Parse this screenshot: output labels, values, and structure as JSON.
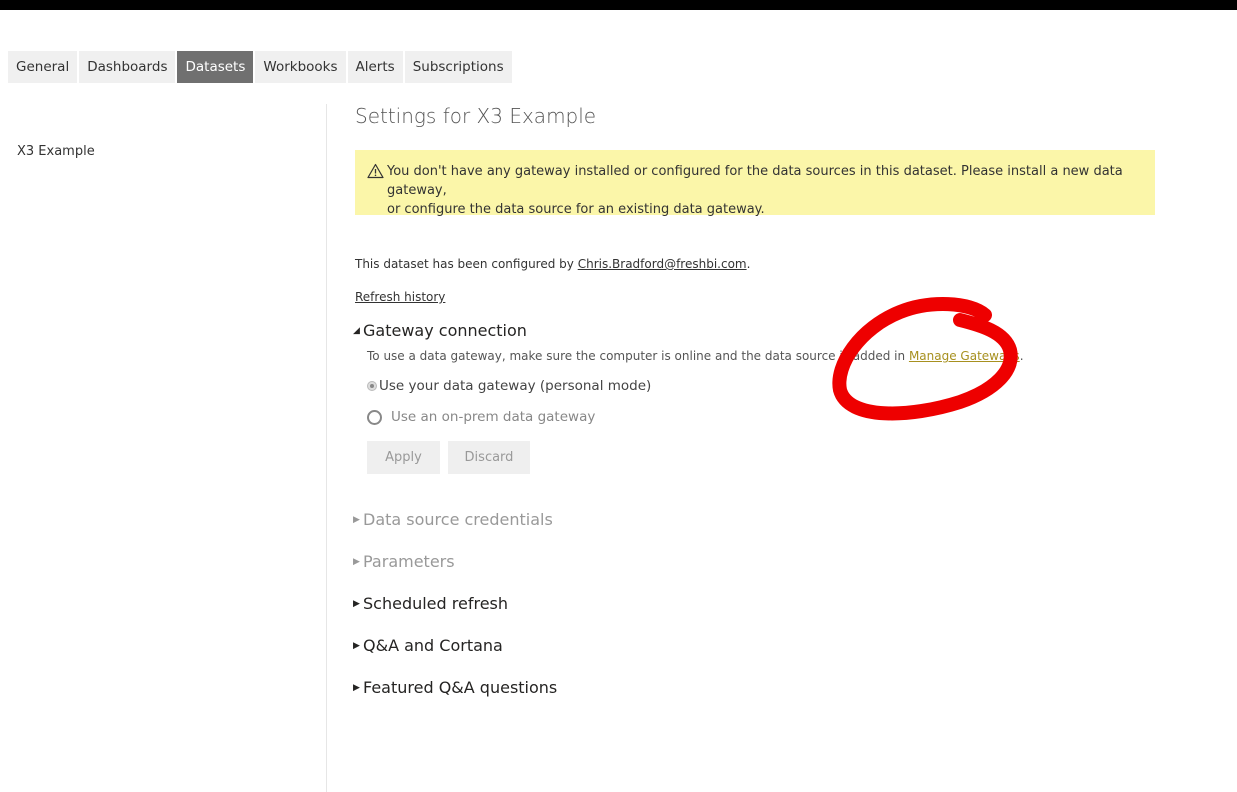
{
  "tabs": [
    "General",
    "Dashboards",
    "Datasets",
    "Workbooks",
    "Alerts",
    "Subscriptions"
  ],
  "active_tab": "Datasets",
  "left_pane": {
    "dataset_name": "X3 Example"
  },
  "page_title": "Settings for X3 Example",
  "warning": {
    "icon": "warning-triangle-icon",
    "line1": "You don't have any gateway installed or configured for the data sources in this dataset. Please install a new data gateway,",
    "line2": "or configure the data source for an existing data gateway."
  },
  "configured": {
    "prefix": "This dataset has been configured by ",
    "email": "Chris.Bradford@freshbi.com",
    "suffix": "."
  },
  "refresh_history": "Refresh history",
  "gateway": {
    "title": "Gateway connection",
    "description_prefix": "To use a data gateway, make sure the computer is online and the data source is added in ",
    "link": "Manage Gateways",
    "description_suffix": ".",
    "option_personal": "Use your data gateway (personal mode)",
    "option_onprem": "Use an on-prem data gateway",
    "apply": "Apply",
    "discard": "Discard"
  },
  "sections": [
    {
      "label": "Data source credentials",
      "enabled": false
    },
    {
      "label": "Parameters",
      "enabled": false
    },
    {
      "label": "Scheduled refresh",
      "enabled": true
    },
    {
      "label": "Q&A and Cortana",
      "enabled": true
    },
    {
      "label": "Featured Q&A questions",
      "enabled": true
    }
  ],
  "colors": {
    "active_tab": "#707070",
    "warning_bg": "#fbf6a9",
    "link": "#a7901f",
    "annotation": "#ee0000"
  }
}
